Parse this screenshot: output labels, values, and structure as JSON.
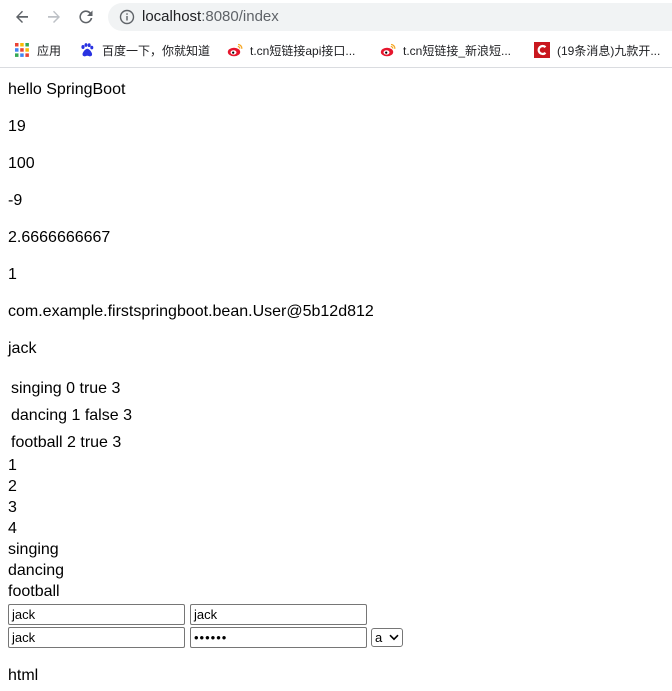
{
  "browser": {
    "url_host": "localhost",
    "url_rest": ":8080/index",
    "bookmarks": [
      {
        "label": "应用",
        "icon": "apps-grid-icon"
      },
      {
        "label": "百度一下，你就知道",
        "icon": "baidu-paw-icon"
      },
      {
        "label": "t.cn短链接api接口...",
        "icon": "weibo-icon"
      },
      {
        "label": "t.cn短链接_新浪短...",
        "icon": "weibo-icon"
      },
      {
        "label": "(19条消息)九款开...",
        "icon": "csdn-c-icon"
      }
    ]
  },
  "page": {
    "greeting": "hello SpringBoot",
    "values": [
      "19",
      "100",
      "-9",
      "2.6666666667",
      "1"
    ],
    "user_object": "com.example.firstspringboot.bean.User@5b12d812",
    "user_name": "jack",
    "hobby_rows": [
      "singing 0 true 3",
      "dancing 1 false 3",
      "football 2 true 3"
    ],
    "numbers": [
      "1",
      "2",
      "3",
      "4"
    ],
    "hobbies": [
      "singing",
      "dancing",
      "football"
    ],
    "form": {
      "input_a": "jack",
      "input_b": "jack",
      "input_c": "jack",
      "password_mask": "••••••",
      "select_value": "a"
    },
    "footer_text": "html"
  },
  "colors": {
    "weibo_red": "#e6162d",
    "csdn_red": "#c9171e",
    "baidu_blue": "#2932e1"
  }
}
